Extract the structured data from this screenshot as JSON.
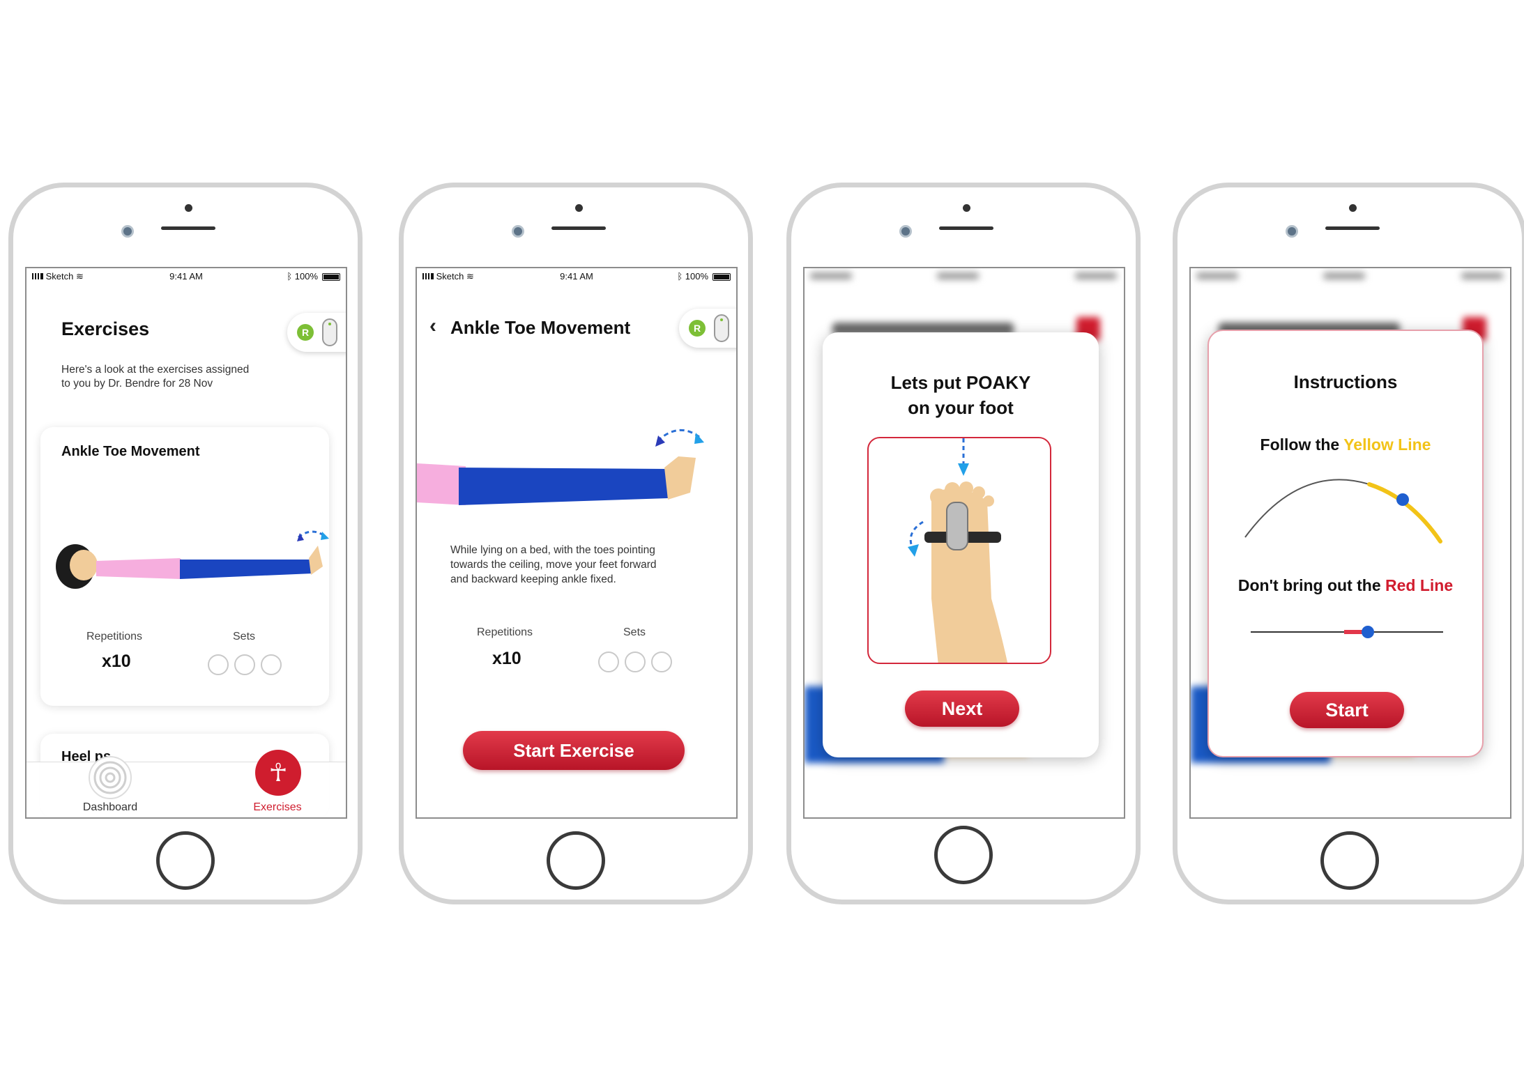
{
  "screen1": {
    "status": {
      "carrier": "Sketch",
      "time": "9:41 AM",
      "battery": "100%"
    },
    "toggle_badge": "R",
    "title": "Exercises",
    "subtitle_line1": "Here's a look at the exercises assigned",
    "subtitle_line2": "to you by Dr. Bendre for 28 Nov",
    "card_title": "Ankle Toe Movement",
    "reps_label": "Repetitions",
    "reps_value": "x10",
    "sets_label": "Sets",
    "next_card_partial": "Heel  ps",
    "nav": {
      "dashboard": "Dashboard",
      "exercises": "Exercises"
    }
  },
  "screen2": {
    "status": {
      "carrier": "Sketch",
      "time": "9:41 AM",
      "battery": "100%"
    },
    "toggle_badge": "R",
    "title": "Ankle Toe Movement",
    "desc_line1": "While lying on a bed, with the toes pointing",
    "desc_line2": "towards the ceiling, move your feet forward",
    "desc_line3": "and backward keeping ankle fixed.",
    "reps_label": "Repetitions",
    "reps_value": "x10",
    "sets_label": "Sets",
    "start_button": "Start Exercise"
  },
  "screen3": {
    "modal_title_line1": "Lets put POAKY",
    "modal_title_line2": "on your foot",
    "next_button": "Next"
  },
  "screen4": {
    "modal_title": "Instructions",
    "follow_prefix": "Follow the ",
    "follow_highlight": "Yellow Line",
    "dont_prefix": "Don't bring out the ",
    "dont_highlight": "Red Line",
    "start_button": "Start"
  },
  "colors": {
    "accent_red": "#c8182c",
    "yellow": "#f2c318",
    "blue_dot": "#1f5fcf",
    "toggle_green": "#7dbf36"
  }
}
